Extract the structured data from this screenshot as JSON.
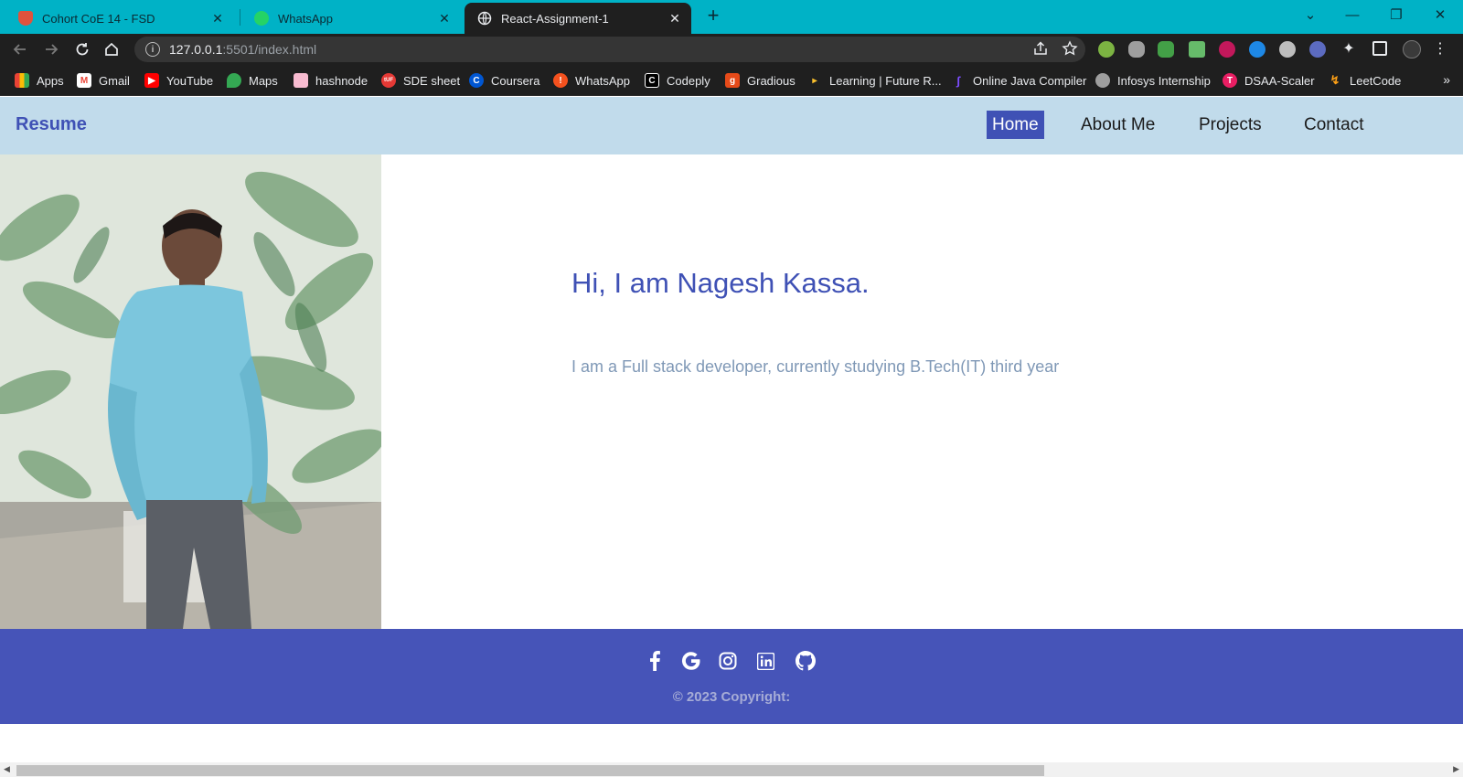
{
  "browser": {
    "tabs": [
      {
        "title": "Cohort CoE 14 - FSD",
        "active": false
      },
      {
        "title": "WhatsApp",
        "active": false
      },
      {
        "title": "React-Assignment-1",
        "active": true
      }
    ],
    "new_tab_label": "+",
    "url_host": "127.0.0.1",
    "url_path": ":5501/index.html",
    "bookmarks": [
      {
        "label": "Apps",
        "icon": "apps-grid-icon"
      },
      {
        "label": "Gmail",
        "icon": "gmail-icon"
      },
      {
        "label": "YouTube",
        "icon": "youtube-icon"
      },
      {
        "label": "Maps",
        "icon": "maps-icon"
      },
      {
        "label": "hashnode",
        "icon": "hashnode-icon"
      },
      {
        "label": "SDE sheet",
        "icon": "sde-sheet-icon"
      },
      {
        "label": "Coursera",
        "icon": "coursera-icon"
      },
      {
        "label": "WhatsApp",
        "icon": "whatsapp-icon"
      },
      {
        "label": "Codeply",
        "icon": "codeply-icon"
      },
      {
        "label": "Gradious",
        "icon": "gradious-icon"
      },
      {
        "label": "Learning | Future R...",
        "icon": "learning-icon"
      },
      {
        "label": "Online Java Compiler",
        "icon": "java-compiler-icon"
      },
      {
        "label": "Infosys Internship",
        "icon": "globe-icon"
      },
      {
        "label": "DSAA-Scaler",
        "icon": "scaler-icon"
      },
      {
        "label": "LeetCode",
        "icon": "leetcode-icon"
      }
    ],
    "more_bookmarks": "»"
  },
  "site": {
    "brand": "Resume",
    "nav": [
      {
        "label": "Home",
        "active": true
      },
      {
        "label": "About Me",
        "active": false
      },
      {
        "label": "Projects",
        "active": false
      },
      {
        "label": "Contact",
        "active": false
      }
    ],
    "hero": {
      "title": "Hi, I am Nagesh Kassa.",
      "subtitle": "I am a Full stack developer, currently studying B.Tech(IT) third year"
    },
    "footer": {
      "social": [
        "facebook-icon",
        "google-icon",
        "instagram-icon",
        "linkedin-icon",
        "github-icon"
      ],
      "copyright": "© 2023 Copyright:"
    }
  },
  "colors": {
    "tabbar": "#00b2c6",
    "nav_bg": "#c1dbeb",
    "accent": "#3f51b5",
    "footer_bg": "#4654b8",
    "subtitle": "#7f98b6"
  }
}
